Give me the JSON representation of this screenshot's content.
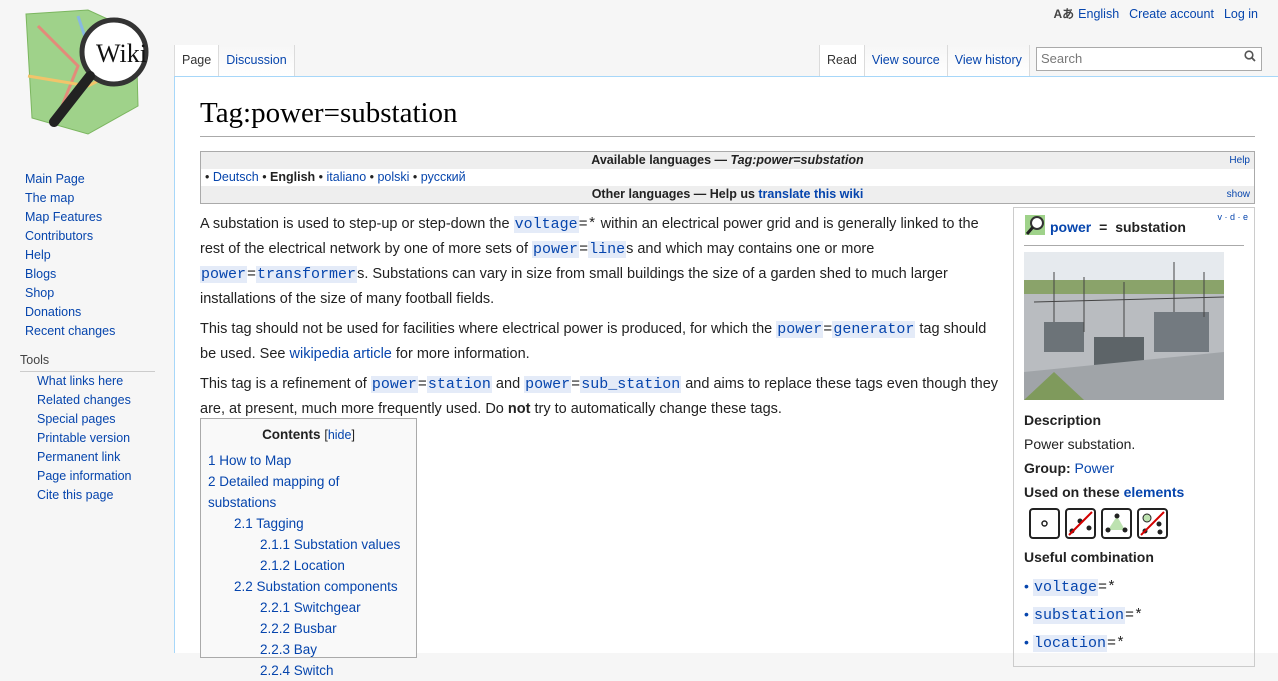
{
  "logo": {
    "text": "Wiki"
  },
  "personal": {
    "lang_icon": "Aあ",
    "language": "English",
    "create_account": "Create account",
    "login": "Log in"
  },
  "nav_main": [
    "Main Page",
    "The map",
    "Map Features",
    "Contributors",
    "Help",
    "Blogs",
    "Shop",
    "Donations",
    "Recent changes"
  ],
  "tools": {
    "heading": "Tools",
    "items": [
      "What links here",
      "Related changes",
      "Special pages",
      "Printable version",
      "Permanent link",
      "Page information",
      "Cite this page"
    ]
  },
  "tabs_left": [
    "Page",
    "Discussion"
  ],
  "tabs_right": [
    "Read",
    "View source",
    "View history"
  ],
  "search": {
    "placeholder": "Search"
  },
  "page": {
    "title": "Tag:power=substation"
  },
  "langbox": {
    "available_prefix": "Available languages — ",
    "available_tag": "Tag:power=substation",
    "help": "Help",
    "languages": [
      "Deutsch",
      "English",
      "italiano",
      "polski",
      "русский"
    ],
    "other_prefix": "Other languages — Help us ",
    "translate": "translate this wiki",
    "show": "show"
  },
  "body": {
    "p1": {
      "a": "A substation is used to step-up or step-down the ",
      "k1": "voltage",
      "v1": "=*",
      "b": " within an electrical power grid and is generally linked to the rest of the electrical network by one of more sets of ",
      "k2": "power",
      "v2": "line",
      "c": "s and which may contains one or more ",
      "k3": "power",
      "v3": "transformer",
      "d": "s. Substations can vary in size from small buildings the size of a garden shed to much larger installations of the size of many football fields."
    },
    "p2": {
      "a": "This tag should not be used for facilities where electrical power is produced, for which the ",
      "k1": "power",
      "v1": "generator",
      "b": " tag should be used. See ",
      "link": "wikipedia article",
      "c": " for more information."
    },
    "p3": {
      "a": "This tag is a refinement of ",
      "k1": "power",
      "v1": "station",
      "b": " and ",
      "k2": "power",
      "v2": "sub_station",
      "c": " and aims to replace these tags even though they are, at present, much more frequently used. Do ",
      "bold": "not",
      "d": " try to automatically change these tags."
    }
  },
  "toc": {
    "title": "Contents",
    "hide": "hide",
    "items": [
      {
        "num": "1",
        "text": "How to Map",
        "level": 1
      },
      {
        "num": "2",
        "text": "Detailed mapping of substations",
        "level": 1
      },
      {
        "num": "2.1",
        "text": "Tagging",
        "level": 2
      },
      {
        "num": "2.1.1",
        "text": "Substation values",
        "level": 3
      },
      {
        "num": "2.1.2",
        "text": "Location",
        "level": 3
      },
      {
        "num": "2.2",
        "text": "Substation components",
        "level": 2
      },
      {
        "num": "2.2.1",
        "text": "Switchgear",
        "level": 3
      },
      {
        "num": "2.2.2",
        "text": "Busbar",
        "level": 3
      },
      {
        "num": "2.2.3",
        "text": "Bay",
        "level": 3
      },
      {
        "num": "2.2.4",
        "text": "Switch",
        "level": 3
      }
    ]
  },
  "infobox": {
    "key": "power",
    "eq": " = ",
    "value": "substation",
    "vde": "v · d · e",
    "description_label": "Description",
    "description": "Power substation.",
    "group_label": "Group:",
    "group": "Power",
    "used_on_prefix": "Used on these ",
    "used_on_link": "elements",
    "useful_label": "Useful combination",
    "combinations": [
      {
        "key": "voltage",
        "val": "=*"
      },
      {
        "key": "substation",
        "val": "=*"
      },
      {
        "key": "location",
        "val": "=*"
      }
    ]
  },
  "colors": {
    "link": "#0645ad",
    "tag_bg": "#e4ebf8",
    "border": "#a7d7f9"
  }
}
